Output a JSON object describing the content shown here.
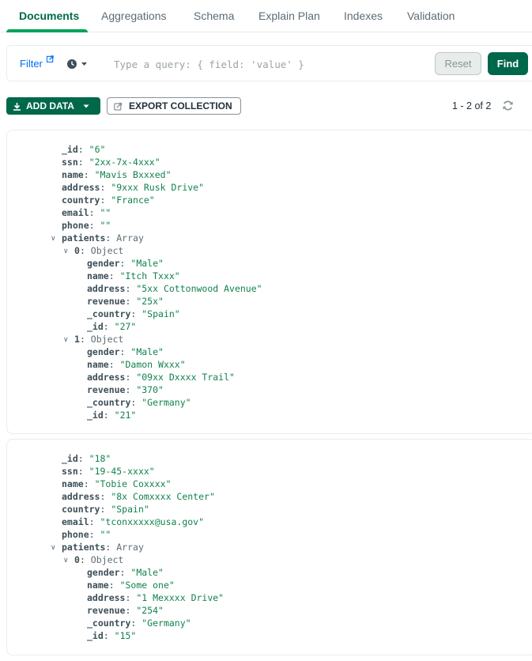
{
  "tabs": [
    {
      "label": "Documents",
      "active": true
    },
    {
      "label": "Aggregations"
    },
    {
      "label": "Schema"
    },
    {
      "label": "Explain Plan"
    },
    {
      "label": "Indexes"
    },
    {
      "label": "Validation"
    }
  ],
  "query_bar": {
    "filter_label": "Filter",
    "placeholder": "Type a query: { field: 'value' }",
    "value": "",
    "reset_label": "Reset",
    "find_label": "Find"
  },
  "toolbar": {
    "add_data_label": "ADD DATA",
    "export_label": "EXPORT COLLECTION",
    "pagination": "1 - 2 of 2"
  },
  "colors": {
    "accent": "#00684a",
    "tab_active": "#016b48",
    "tab_underline": "#00a35c",
    "link": "#016bf8",
    "string_value": "#12824d"
  },
  "documents": [
    {
      "fields": [
        {
          "key": "_id",
          "value": "\"6\""
        },
        {
          "key": "ssn",
          "value": "\"2xx-7x-4xxx\""
        },
        {
          "key": "name",
          "value": "\"Mavis Bxxxed\""
        },
        {
          "key": "address",
          "value": "\"9xxx Rusk Drive\""
        },
        {
          "key": "country",
          "value": "\"France\""
        },
        {
          "key": "email",
          "value": "\"\""
        },
        {
          "key": "phone",
          "value": "\"\""
        }
      ],
      "patients_key": "patients",
      "patients_type": "Array",
      "patients": [
        {
          "index": "0",
          "type": "Object",
          "fields": [
            {
              "key": "gender",
              "value": "\"Male\""
            },
            {
              "key": "name",
              "value": "\"Itch Txxx\""
            },
            {
              "key": "address",
              "value": "\"5xx Cottonwood Avenue\""
            },
            {
              "key": "revenue",
              "value": "\"25x\""
            },
            {
              "key": "_country",
              "value": "\"Spain\""
            },
            {
              "key": "_id",
              "value": "\"27\""
            }
          ]
        },
        {
          "index": "1",
          "type": "Object",
          "fields": [
            {
              "key": "gender",
              "value": "\"Male\""
            },
            {
              "key": "name",
              "value": "\"Damon Wxxx\""
            },
            {
              "key": "address",
              "value": "\"09xx Dxxxx Trail\""
            },
            {
              "key": "revenue",
              "value": "\"370\""
            },
            {
              "key": "_country",
              "value": "\"Germany\""
            },
            {
              "key": "_id",
              "value": "\"21\""
            }
          ]
        }
      ]
    },
    {
      "fields": [
        {
          "key": "_id",
          "value": "\"18\""
        },
        {
          "key": "ssn",
          "value": "\"19-45-xxxx\""
        },
        {
          "key": "name",
          "value": "\"Tobie Coxxxx\""
        },
        {
          "key": "address",
          "value": "\"8x Comxxxx Center\""
        },
        {
          "key": "country",
          "value": "\"Spain\""
        },
        {
          "key": "email",
          "value": "\"tconxxxxx@usa.gov\""
        },
        {
          "key": "phone",
          "value": "\"\""
        }
      ],
      "patients_key": "patients",
      "patients_type": "Array",
      "patients": [
        {
          "index": "0",
          "type": "Object",
          "fields": [
            {
              "key": "gender",
              "value": "\"Male\""
            },
            {
              "key": "name",
              "value": "\"Some one\""
            },
            {
              "key": "address",
              "value": "\"1 Mexxxx Drive\""
            },
            {
              "key": "revenue",
              "value": "\"254\""
            },
            {
              "key": "_country",
              "value": "\"Germany\""
            },
            {
              "key": "_id",
              "value": "\"15\""
            }
          ]
        }
      ]
    }
  ]
}
